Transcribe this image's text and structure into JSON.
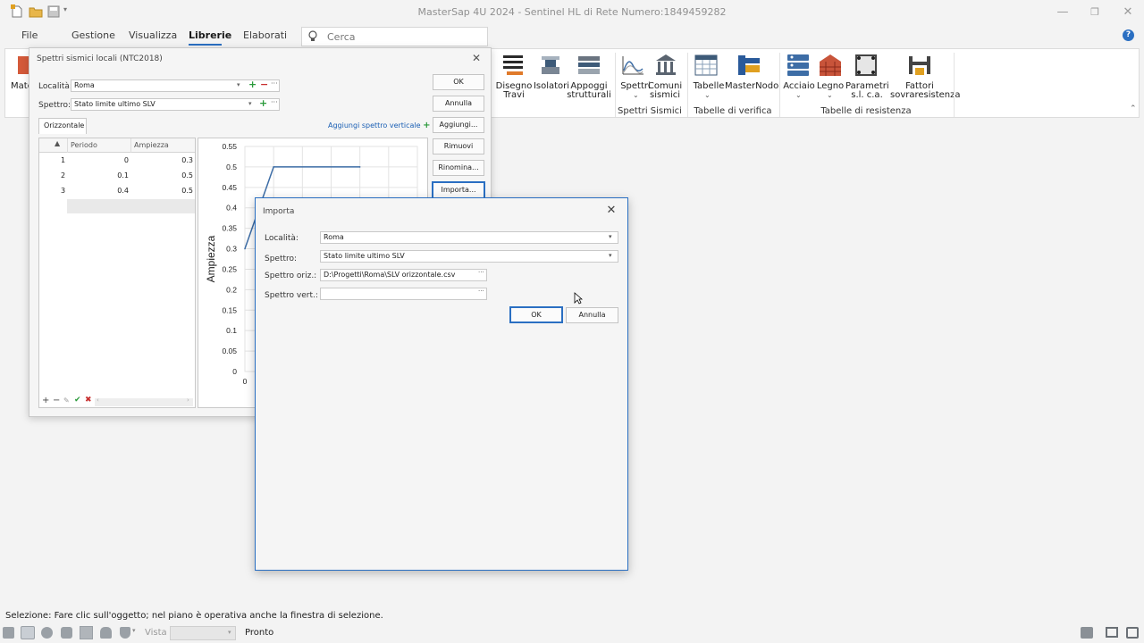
{
  "app": {
    "title": "MasterSap 4U 2024 - Sentinel HL di Rete Numero:1849459282"
  },
  "menu": {
    "items": [
      "File",
      "Gestione",
      "Visualizza",
      "Librerie",
      "Elaborati"
    ],
    "active": "Librerie"
  },
  "search": {
    "placeholder": "Cerca"
  },
  "ribbon": {
    "left_partial_label": "Mate",
    "buttons": {
      "disegno_travi": [
        "Disegno",
        "Travi"
      ],
      "isolatori": "Isolatori",
      "appoggi": [
        "Appoggi",
        "strutturali"
      ],
      "spettri": "Spettri",
      "comuni": [
        "Comuni",
        "sismici"
      ],
      "tabelle": "Tabelle",
      "masternodo": "MasterNodo",
      "acciaio": "Acciaio",
      "legno": "Legno",
      "parametri": [
        "Parametri",
        "s.l. c.a."
      ],
      "fattori": [
        "Fattori",
        "sovraresistenza"
      ]
    },
    "groups": [
      "Spettri Sismici",
      "Tabelle di verifica",
      "Tabelle di resistenza"
    ]
  },
  "dialog_spettri": {
    "title": "Spettri sismici locali (NTC2018)",
    "localita_label": "Località:",
    "localita_value": "Roma",
    "spettro_label": "Spettro:",
    "spettro_value": "Stato limite ultimo SLV",
    "tab": "Orizzontale",
    "add_vertical_link": "Aggiungi spettro verticale",
    "buttons": [
      "OK",
      "Annulla",
      "Aggiungi...",
      "Rimuovi",
      "Rinomina...",
      "Importa..."
    ],
    "table": {
      "columns": [
        "Periodo",
        "Ampiezza"
      ],
      "rows": [
        {
          "n": "1",
          "periodo": "0",
          "ampiezza": "0.3"
        },
        {
          "n": "2",
          "periodo": "0.1",
          "ampiezza": "0.5"
        },
        {
          "n": "3",
          "periodo": "0.4",
          "ampiezza": "0.5"
        }
      ]
    }
  },
  "chart_data": {
    "type": "line",
    "ylabel": "Ampiezza",
    "xlabel": "",
    "ylim": [
      0,
      0.55
    ],
    "y_ticks": [
      "0.55",
      "0.5",
      "0.45",
      "0.4",
      "0.35",
      "0.3",
      "0.25",
      "0.2",
      "0.15",
      "0.1",
      "0.05",
      "0"
    ],
    "x_ticks": [
      "0"
    ],
    "grid": true,
    "series": [
      {
        "x": [
          0,
          0.1,
          0.4
        ],
        "y": [
          0.3,
          0.5,
          0.5
        ]
      }
    ],
    "line_color": "#3d6da6"
  },
  "dialog_importa": {
    "title": "Importa",
    "localita_label": "Località:",
    "localita_value": "Roma",
    "spettro_label": "Spettro:",
    "spettro_value": "Stato limite ultimo SLV",
    "oriz_label": "Spettro oriz.:",
    "oriz_value": "D:\\Progetti\\Roma\\SLV orizzontale.csv",
    "vert_label": "Spettro vert.:",
    "vert_value": "",
    "ok": "OK",
    "annulla": "Annulla"
  },
  "status": {
    "message": "Selezione: Fare clic sull'oggetto; nel piano è operativa anche la finestra di selezione.",
    "vista_label": "Vista",
    "pronto": "Pronto"
  }
}
